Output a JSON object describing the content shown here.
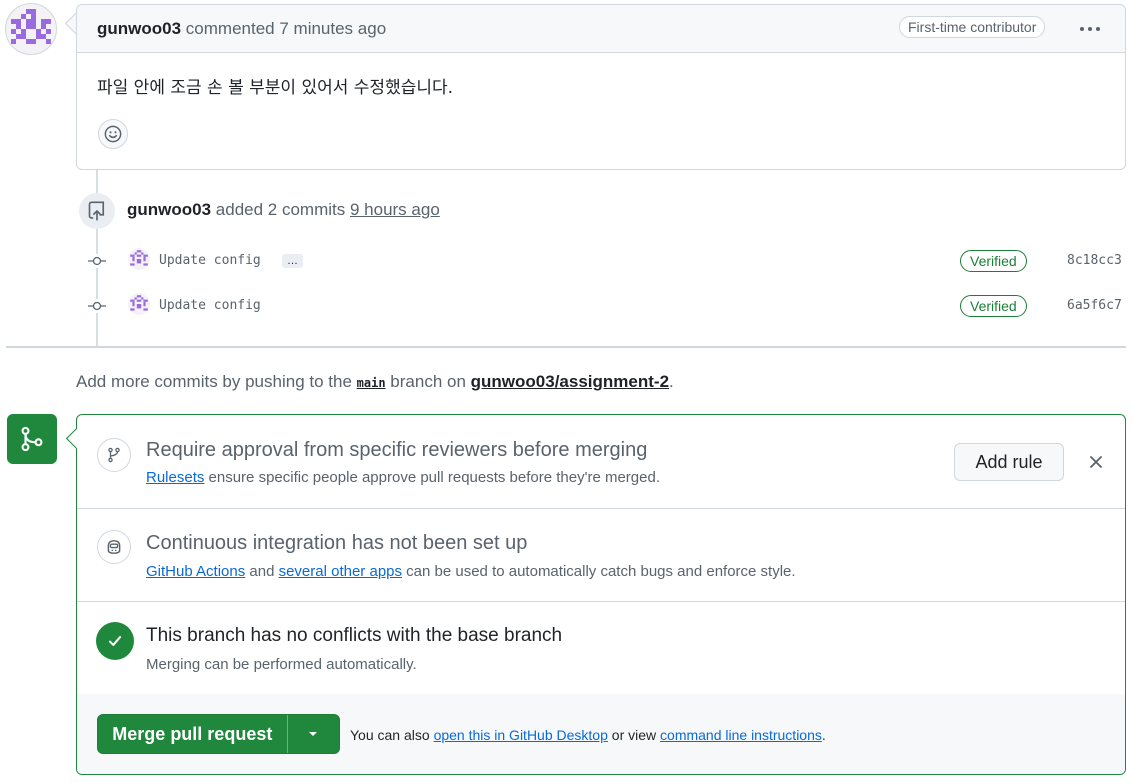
{
  "comment": {
    "author": "gunwoo03",
    "action": "commented",
    "time": "7 minutes ago",
    "badge": "First-time contributor",
    "more_icon": "kebab-horizontal-icon",
    "body": "파일 안에 조금 손 볼 부분이 있어서 수정했습니다.",
    "reaction_icon": "smiley-icon"
  },
  "timeline": {
    "author": "gunwoo03",
    "action": "added 2 commits",
    "time": "9 hours ago",
    "icon": "repo-push-icon",
    "commits": [
      {
        "message": "Update config",
        "has_more": true,
        "more_label": "…",
        "verified": "Verified",
        "sha": "8c18cc3"
      },
      {
        "message": "Update config",
        "has_more": false,
        "more_label": "",
        "verified": "Verified",
        "sha": "6a5f6c7"
      }
    ]
  },
  "hint": {
    "prefix": "Add more commits by pushing to the",
    "branch": "main",
    "middle": "branch on",
    "repo": "gunwoo03/assignment-2",
    "suffix": "."
  },
  "merge": {
    "icon": "git-merge-icon",
    "rules": {
      "title": "Require approval from specific reviewers before merging",
      "link": "Rulesets",
      "text": "ensure specific people approve pull requests before they're merged.",
      "button": "Add rule",
      "icon": "git-branch-icon",
      "close_icon": "close-icon"
    },
    "ci": {
      "title": "Continuous integration has not been set up",
      "link1": "GitHub Actions",
      "and": "and",
      "link2": "several other apps",
      "text": "can be used to automatically catch bugs and enforce style.",
      "icon": "copilot-icon"
    },
    "conflicts": {
      "title": "This branch has no conflicts with the base branch",
      "text": "Merging can be performed automatically.",
      "icon": "check-icon"
    },
    "footer": {
      "button": "Merge pull request",
      "caret_icon": "triangle-down-icon",
      "prefix": "You can also",
      "link1": "open this in GitHub Desktop",
      "middle": "or view",
      "link2": "command line instructions",
      "suffix": "."
    }
  },
  "colors": {
    "green": "#1f883d",
    "link": "#0969da",
    "avatar_purple": "#8b5bd9"
  }
}
